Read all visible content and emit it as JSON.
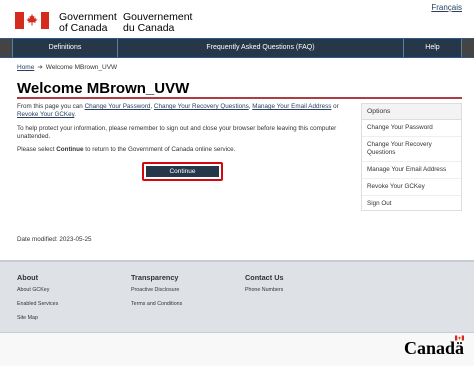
{
  "header": {
    "language_link": "Français",
    "sig_en_line1": "Government",
    "sig_en_line2": "of Canada",
    "sig_fr_line1": "Gouvernement",
    "sig_fr_line2": "du Canada"
  },
  "nav": {
    "items": [
      {
        "label": "Definitions"
      },
      {
        "label": "Frequently Asked Questions (FAQ)"
      },
      {
        "label": "Help"
      }
    ]
  },
  "breadcrumb": {
    "home": "Home",
    "current": "Welcome MBrown_UVW"
  },
  "main": {
    "title": "Welcome MBrown_UVW",
    "intro_text_1": "From this page you can ",
    "intro_link_1": "Change Your Password",
    "intro_text_2": ", ",
    "intro_link_2": "Change Your Recovery Questions",
    "intro_text_3": ", ",
    "intro_link_3": "Manage Your Email Address",
    "intro_text_4": " or ",
    "intro_link_4": "Revoke Your GCKey",
    "intro_text_5": ".",
    "protect_text": "To help protect your information, please remember to sign out and close your browser before leaving this computer unattended.",
    "select_text_1": "Please select ",
    "select_bold": "Continue",
    "select_text_2": " to return to the Government of Canada online service.",
    "continue_button": "Continue",
    "date_modified": "Date modified: 2023-05-25"
  },
  "options": {
    "heading": "Options",
    "items": [
      {
        "label": "Change Your Password"
      },
      {
        "label": "Change Your Recovery Questions"
      },
      {
        "label": "Manage Your Email Address"
      },
      {
        "label": "Revoke Your GCKey"
      },
      {
        "label": "Sign Out"
      }
    ]
  },
  "footer": {
    "about": {
      "heading": "About",
      "links": [
        "About GCKey",
        "Enabled Services",
        "Site Map"
      ]
    },
    "transparency": {
      "heading": "Transparency",
      "links": [
        "Proactive Disclosure",
        "Terms and Conditions"
      ]
    },
    "contact": {
      "heading": "Contact Us",
      "links": [
        "Phone Numbers"
      ]
    },
    "wordmark": "Canadä"
  },
  "colors": {
    "nav_bg": "#26374a",
    "accent_red": "#af3c43",
    "link": "#284162",
    "flag_red": "#d52b1e"
  }
}
